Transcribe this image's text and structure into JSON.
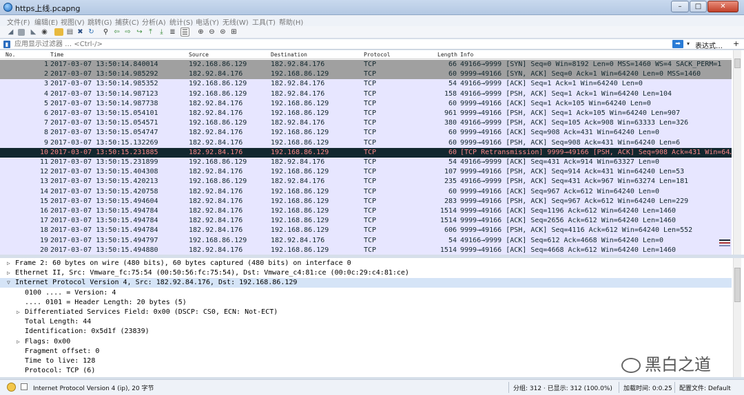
{
  "window": {
    "title": "https上线.pcapng",
    "minimize_label": "–",
    "maximize_label": "□",
    "close_label": "✕"
  },
  "menu": [
    "文件(F)",
    "编辑(E)",
    "视图(V)",
    "跳转(G)",
    "捕获(C)",
    "分析(A)",
    "统计(S)",
    "电话(Y)",
    "无线(W)",
    "工具(T)",
    "帮助(H)"
  ],
  "toolbar_icons": [
    "shark-fin-start-icon",
    "stop-icon",
    "restart-icon",
    "options-gear-icon",
    "open-folder-icon",
    "save-icon",
    "close-file-icon",
    "reload-icon",
    "find-icon",
    "back-arrow-icon",
    "forward-arrow-icon",
    "go-to-packet-icon",
    "first-packet-icon",
    "last-packet-icon",
    "autoscroll-icon",
    "colorize-icon",
    "zoom-in-icon",
    "zoom-out-icon",
    "zoom-normal-icon",
    "resize-columns-icon"
  ],
  "filter": {
    "placeholder": "应用显示过滤器 … <Ctrl-/>",
    "expression_label": "表达式…",
    "plus_label": "+"
  },
  "packet_list": {
    "columns": [
      "No.",
      "Time",
      "Source",
      "Destination",
      "Protocol",
      "Length",
      "Info"
    ],
    "rows": [
      {
        "no": "1",
        "time": "2017-03-07 13:50:14.840014",
        "src": "192.168.86.129",
        "dst": "182.92.84.176",
        "proto": "TCP",
        "len": "66",
        "info": "49166→9999 [SYN] Seq=0 Win=8192 Len=0 MSS=1460 WS=4 SACK_PERM=1",
        "style": "gray"
      },
      {
        "no": "2",
        "time": "2017-03-07 13:50:14.985292",
        "src": "182.92.84.176",
        "dst": "192.168.86.129",
        "proto": "TCP",
        "len": "60",
        "info": "9999→49166 [SYN, ACK] Seq=0 Ack=1 Win=64240 Len=0 MSS=1460",
        "style": "gray"
      },
      {
        "no": "3",
        "time": "2017-03-07 13:50:14.985352",
        "src": "192.168.86.129",
        "dst": "182.92.84.176",
        "proto": "TCP",
        "len": "54",
        "info": "49166→9999 [ACK] Seq=1 Ack=1 Win=64240 Len=0",
        "style": "normal"
      },
      {
        "no": "4",
        "time": "2017-03-07 13:50:14.987123",
        "src": "192.168.86.129",
        "dst": "182.92.84.176",
        "proto": "TCP",
        "len": "158",
        "info": "49166→9999 [PSH, ACK] Seq=1 Ack=1 Win=64240 Len=104",
        "style": "normal"
      },
      {
        "no": "5",
        "time": "2017-03-07 13:50:14.987738",
        "src": "182.92.84.176",
        "dst": "192.168.86.129",
        "proto": "TCP",
        "len": "60",
        "info": "9999→49166 [ACK] Seq=1 Ack=105 Win=64240 Len=0",
        "style": "normal"
      },
      {
        "no": "6",
        "time": "2017-03-07 13:50:15.054101",
        "src": "182.92.84.176",
        "dst": "192.168.86.129",
        "proto": "TCP",
        "len": "961",
        "info": "9999→49166 [PSH, ACK] Seq=1 Ack=105 Win=64240 Len=907",
        "style": "normal"
      },
      {
        "no": "7",
        "time": "2017-03-07 13:50:15.054571",
        "src": "192.168.86.129",
        "dst": "182.92.84.176",
        "proto": "TCP",
        "len": "380",
        "info": "49166→9999 [PSH, ACK] Seq=105 Ack=908 Win=63333 Len=326",
        "style": "normal"
      },
      {
        "no": "8",
        "time": "2017-03-07 13:50:15.054747",
        "src": "182.92.84.176",
        "dst": "192.168.86.129",
        "proto": "TCP",
        "len": "60",
        "info": "9999→49166 [ACK] Seq=908 Ack=431 Win=64240 Len=0",
        "style": "normal"
      },
      {
        "no": "9",
        "time": "2017-03-07 13:50:15.132269",
        "src": "182.92.84.176",
        "dst": "192.168.86.129",
        "proto": "TCP",
        "len": "60",
        "info": "9999→49166 [PSH, ACK] Seq=908 Ack=431 Win=64240 Len=6",
        "style": "normal"
      },
      {
        "no": "10",
        "time": "2017-03-07 13:50:15.231885",
        "src": "182.92.84.176",
        "dst": "192.168.86.129",
        "proto": "TCP",
        "len": "60",
        "info": "[TCP Retransmission] 9999→49166 [PSH, ACK] Seq=908 Ack=431 Win=64…",
        "style": "dark"
      },
      {
        "no": "11",
        "time": "2017-03-07 13:50:15.231899",
        "src": "192.168.86.129",
        "dst": "182.92.84.176",
        "proto": "TCP",
        "len": "54",
        "info": "49166→9999 [ACK] Seq=431 Ack=914 Win=63327 Len=0",
        "style": "normal"
      },
      {
        "no": "12",
        "time": "2017-03-07 13:50:15.404308",
        "src": "182.92.84.176",
        "dst": "192.168.86.129",
        "proto": "TCP",
        "len": "107",
        "info": "9999→49166 [PSH, ACK] Seq=914 Ack=431 Win=64240 Len=53",
        "style": "normal"
      },
      {
        "no": "13",
        "time": "2017-03-07 13:50:15.420213",
        "src": "192.168.86.129",
        "dst": "182.92.84.176",
        "proto": "TCP",
        "len": "235",
        "info": "49166→9999 [PSH, ACK] Seq=431 Ack=967 Win=63274 Len=181",
        "style": "normal"
      },
      {
        "no": "14",
        "time": "2017-03-07 13:50:15.420758",
        "src": "182.92.84.176",
        "dst": "192.168.86.129",
        "proto": "TCP",
        "len": "60",
        "info": "9999→49166 [ACK] Seq=967 Ack=612 Win=64240 Len=0",
        "style": "normal"
      },
      {
        "no": "15",
        "time": "2017-03-07 13:50:15.494604",
        "src": "182.92.84.176",
        "dst": "192.168.86.129",
        "proto": "TCP",
        "len": "283",
        "info": "9999→49166 [PSH, ACK] Seq=967 Ack=612 Win=64240 Len=229",
        "style": "normal"
      },
      {
        "no": "16",
        "time": "2017-03-07 13:50:15.494784",
        "src": "182.92.84.176",
        "dst": "192.168.86.129",
        "proto": "TCP",
        "len": "1514",
        "info": "9999→49166 [ACK] Seq=1196 Ack=612 Win=64240 Len=1460",
        "style": "normal"
      },
      {
        "no": "17",
        "time": "2017-03-07 13:50:15.494784",
        "src": "182.92.84.176",
        "dst": "192.168.86.129",
        "proto": "TCP",
        "len": "1514",
        "info": "9999→49166 [ACK] Seq=2656 Ack=612 Win=64240 Len=1460",
        "style": "normal"
      },
      {
        "no": "18",
        "time": "2017-03-07 13:50:15.494784",
        "src": "182.92.84.176",
        "dst": "192.168.86.129",
        "proto": "TCP",
        "len": "606",
        "info": "9999→49166 [PSH, ACK] Seq=4116 Ack=612 Win=64240 Len=552",
        "style": "normal"
      },
      {
        "no": "19",
        "time": "2017-03-07 13:50:15.494797",
        "src": "192.168.86.129",
        "dst": "182.92.84.176",
        "proto": "TCP",
        "len": "54",
        "info": "49166→9999 [ACK] Seq=612 Ack=4668 Win=64240 Len=0",
        "style": "normal"
      },
      {
        "no": "20",
        "time": "2017-03-07 13:50:15.494880",
        "src": "182.92.84.176",
        "dst": "192.168.86.129",
        "proto": "TCP",
        "len": "1514",
        "info": "9999→49166 [ACK] Seq=4668 Ack=612 Win=64240 Len=1460",
        "style": "normal"
      }
    ]
  },
  "details": [
    {
      "indent": 0,
      "expander": "▷",
      "text": "Frame 2: 60 bytes on wire (480 bits), 60 bytes captured (480 bits) on interface 0",
      "selected": false
    },
    {
      "indent": 0,
      "expander": "▷",
      "text": "Ethernet II, Src: Vmware_fc:75:54 (00:50:56:fc:75:54), Dst: Vmware_c4:81:ce (00:0c:29:c4:81:ce)",
      "selected": false
    },
    {
      "indent": 0,
      "expander": "▽",
      "text": "Internet Protocol Version 4, Src: 182.92.84.176, Dst: 192.168.86.129",
      "selected": true
    },
    {
      "indent": 1,
      "expander": "",
      "text": "0100 .... = Version: 4",
      "selected": false
    },
    {
      "indent": 1,
      "expander": "",
      "text": ".... 0101 = Header Length: 20 bytes (5)",
      "selected": false
    },
    {
      "indent": 1,
      "expander": "▷",
      "text": "Differentiated Services Field: 0x00 (DSCP: CS0, ECN: Not-ECT)",
      "selected": false
    },
    {
      "indent": 1,
      "expander": "",
      "text": "Total Length: 44",
      "selected": false
    },
    {
      "indent": 1,
      "expander": "",
      "text": "Identification: 0x5d1f (23839)",
      "selected": false
    },
    {
      "indent": 1,
      "expander": "▷",
      "text": "Flags: 0x00",
      "selected": false
    },
    {
      "indent": 1,
      "expander": "",
      "text": "Fragment offset: 0",
      "selected": false
    },
    {
      "indent": 1,
      "expander": "",
      "text": "Time to live: 128",
      "selected": false
    },
    {
      "indent": 1,
      "expander": "",
      "text": "Protocol: TCP (6)",
      "selected": false
    }
  ],
  "watermark": "黑白之道",
  "statusbar": {
    "field": "Internet Protocol Version 4 (ip), 20 字节",
    "packets": "分组: 312 · 已显示: 312 (100.0%)",
    "load_time": "加载时间: 0:0.25",
    "profile": "配置文件: Default"
  },
  "colors": {
    "tcp_row": "#e7e6ff",
    "syn_row": "#a0a0a0",
    "retrans_row": "#12272e",
    "retrans_text": "#f78787",
    "selected_detail": "#d5e4f7"
  }
}
